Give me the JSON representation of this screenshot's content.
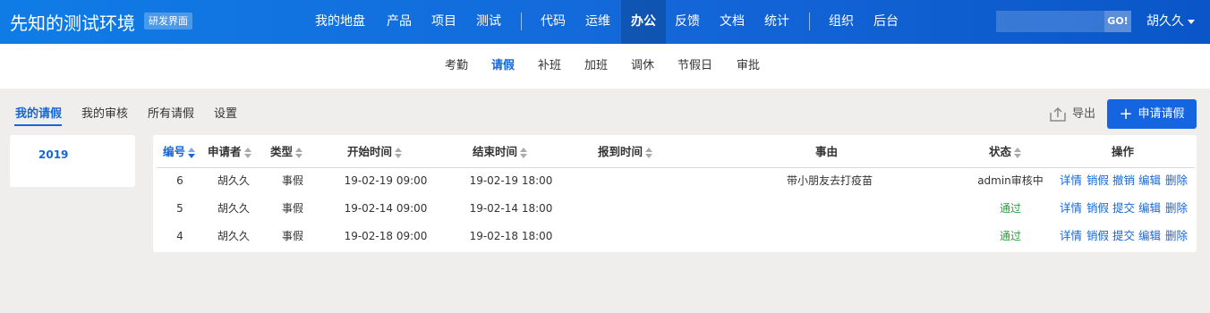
{
  "header": {
    "title": "先知的测试环境",
    "badge": "研发界面",
    "nav": [
      {
        "label": "我的地盘"
      },
      {
        "label": "产品"
      },
      {
        "label": "项目"
      },
      {
        "label": "测试"
      },
      {
        "label": "代码"
      },
      {
        "label": "运维"
      },
      {
        "label": "办公",
        "active": true
      },
      {
        "label": "反馈"
      },
      {
        "label": "文档"
      },
      {
        "label": "统计"
      },
      {
        "label": "组织"
      },
      {
        "label": "后台"
      }
    ],
    "search": {
      "value": "",
      "button": "GO!"
    },
    "user": "胡久久"
  },
  "subnav": {
    "items": [
      {
        "label": "考勤"
      },
      {
        "label": "请假",
        "active": true
      },
      {
        "label": "补班"
      },
      {
        "label": "加班"
      },
      {
        "label": "调休"
      },
      {
        "label": "节假日"
      },
      {
        "label": "审批"
      }
    ]
  },
  "tabs": [
    {
      "label": "我的请假",
      "active": true
    },
    {
      "label": "我的审核"
    },
    {
      "label": "所有请假"
    },
    {
      "label": "设置"
    }
  ],
  "toolbar": {
    "export_label": "导出",
    "apply_label": "申请请假"
  },
  "years": [
    "2019"
  ],
  "table": {
    "columns": [
      "编号",
      "申请者",
      "类型",
      "开始时间",
      "结束时间",
      "报到时间",
      "事由",
      "状态",
      "操作"
    ],
    "rows": [
      {
        "id": "6",
        "applicant": "胡久久",
        "type": "事假",
        "start": "19-02-19 09:00",
        "end": "19-02-19 18:00",
        "report": "",
        "reason": "带小朋友去打疫苗",
        "status": "admin审核中",
        "actions": [
          "详情",
          "销假",
          "撤销",
          "编辑",
          "删除"
        ]
      },
      {
        "id": "5",
        "applicant": "胡久久",
        "type": "事假",
        "start": "19-02-14 09:00",
        "end": "19-02-14 18:00",
        "report": "",
        "reason": "",
        "status": "通过",
        "actions": [
          "详情",
          "销假",
          "提交",
          "编辑",
          "删除"
        ]
      },
      {
        "id": "4",
        "applicant": "胡久久",
        "type": "事假",
        "start": "19-02-18 09:00",
        "end": "19-02-18 18:00",
        "report": "",
        "reason": "",
        "status": "通过",
        "actions": [
          "详情",
          "销假",
          "提交",
          "编辑",
          "删除"
        ]
      }
    ]
  },
  "colors": {
    "accent": "#1467d9",
    "pass": "#22a13a"
  }
}
